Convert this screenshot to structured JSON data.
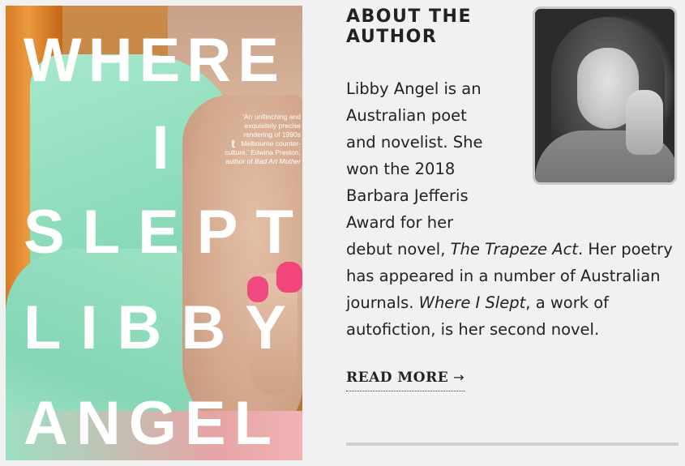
{
  "cover": {
    "title_words": [
      "WHERE",
      "I",
      "SLEPT"
    ],
    "author_words": [
      "LIBBY",
      "ANGEL"
    ],
    "publisher_mark": "t",
    "quote": "'An unflinching and exquisitely precise rendering of 1990s Melbourne counter-culture.' Edwina Preston, author of",
    "quote_book": "Bad Art Mother"
  },
  "about": {
    "heading": "ABOUT THE AUTHOR",
    "bio_line1": "Libby Angel is an",
    "bio_line2": "Australian poet",
    "bio_line3": "and novelist. She",
    "bio_line4": "won the 2018",
    "bio_line5": "Barbara Jefferis",
    "bio_line6": "Award for her",
    "bio_rest_a": "debut novel, ",
    "bio_book1": "The Trapeze Act",
    "bio_rest_b": ". Her poetry has appeared in a number of Australian journals. ",
    "bio_book2": "Where I Slept",
    "bio_rest_c": ", a work of autofiction, is her second novel.",
    "read_more": "READ MORE",
    "read_more_icon": "arrow-right-icon"
  }
}
